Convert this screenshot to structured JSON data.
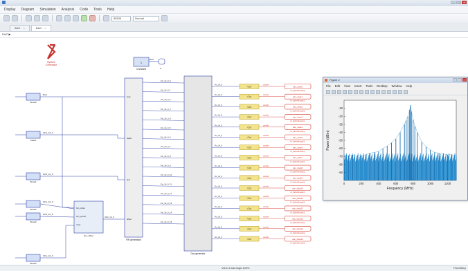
{
  "app": {
    "title": "",
    "menu": [
      "Display",
      "Diagram",
      "Simulation",
      "Analysis",
      "Code",
      "Tools",
      "Help"
    ],
    "toolbar": {
      "stop_time": "85536",
      "sim_mode": "Normal"
    },
    "tabs": [
      {
        "label": "ADC",
        "active": false
      },
      {
        "label": "DAC",
        "active": true
      }
    ],
    "breadcrumb": "DAC ▶",
    "status": {
      "left": "",
      "zoom": "View 3 warnings  100%",
      "solver": "FixedStep"
    }
  },
  "diagram": {
    "logo": {
      "line1": "System",
      "line2": "Generator"
    },
    "constant": {
      "value": "1",
      "label": "Constant",
      "out_type": "Bool",
      "terminator": "A"
    },
    "sources": [
      {
        "name": "Shsel0",
        "type": "Bool"
      },
      {
        "name": "Stable",
        "type": "UFix_16_0"
      },
      {
        "name": "Shsel1",
        "type": "UFix_16_0"
      },
      {
        "name": "Shsel2",
        "type": "UFix_16_0"
      },
      {
        "name": "Shsel3",
        "type": "UFix_16_0"
      },
      {
        "name": "Shsel4",
        "type": "UFix_16_0"
      }
    ],
    "fsm": {
      "label": "fsm_offset",
      "ports_in": [
        "fsm_offset",
        "fsm_period",
        "reset"
      ],
      "port_out": "UFix_16_0"
    },
    "fir": {
      "label": "FIR generation",
      "ports_in": [
        "load",
        "data0",
        "pins",
        "offset"
      ],
      "outputs": 16
    },
    "dac_gen": {
      "label": "Dac generator",
      "signal": "Fix_14_0",
      "channels": 16
    },
    "gateway": {
      "label": "Out",
      "note": "double"
    },
    "outputs": [
      "dac_data0",
      "dac_data1",
      "dac_data2",
      "dac_data3",
      "dac_data4",
      "dac_data5",
      "dac_data6",
      "dac_data7",
      "dac_data8",
      "dac_data9",
      "dac_data10",
      "dac_data11",
      "dac_data12",
      "dac_data13",
      "dac_data14",
      "dac_data15"
    ],
    "sample_rate_note": "Fs_BufferWindow(1)"
  },
  "figure": {
    "title": "Figure 2",
    "menu": [
      "File",
      "Edit",
      "View",
      "Insert",
      "Tools",
      "Desktop",
      "Window",
      "Help"
    ]
  },
  "chart_data": {
    "type": "line",
    "title": "",
    "xlabel": "Frequency (MHz)",
    "ylabel": "Power (dBm)",
    "xlim": [
      0,
      1300
    ],
    "ylim": [
      -100,
      0
    ],
    "xticks": [
      0,
      200,
      400,
      600,
      800,
      1000,
      1200
    ],
    "yticks": [
      -10,
      -20,
      -30,
      -40,
      -50,
      -60,
      -70,
      -80,
      -90
    ],
    "grid": false,
    "color": "#2b8fd0",
    "series": [
      {
        "x": [
          0,
          50,
          100,
          150,
          200,
          250,
          300,
          350,
          400,
          450,
          500,
          550,
          600,
          650,
          700,
          720,
          740,
          760,
          770,
          780,
          800,
          820,
          850,
          900,
          950,
          1000,
          1050,
          1100,
          1150,
          1200,
          1250,
          1300
        ],
        "values": [
          -68,
          -69,
          -68,
          -70,
          -69,
          -68,
          -66,
          -65,
          -64,
          -60,
          -57,
          -53,
          -48,
          -40,
          -30,
          -25,
          -20,
          -12,
          -6,
          -14,
          -24,
          -32,
          -40,
          -52,
          -58,
          -62,
          -65,
          -66,
          -67,
          -68,
          -68,
          -69
        ]
      }
    ],
    "floor": -74
  }
}
